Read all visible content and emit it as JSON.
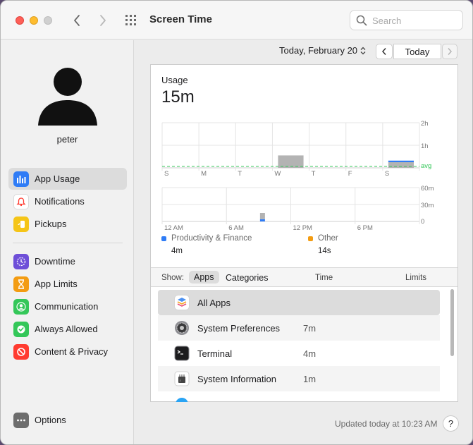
{
  "window": {
    "title": "Screen Time"
  },
  "search": {
    "placeholder": "Search"
  },
  "user": {
    "name": "peter"
  },
  "sidebar": {
    "group1": [
      {
        "label": "App Usage",
        "icon": "bar-chart-icon",
        "color": "#2f7cf6",
        "selected": true
      },
      {
        "label": "Notifications",
        "icon": "bell-icon",
        "color": "#ffffff",
        "selected": false
      },
      {
        "label": "Pickups",
        "icon": "pickup-phone-icon",
        "color": "#f5c518",
        "selected": false
      }
    ],
    "group2": [
      {
        "label": "Downtime",
        "icon": "downtime-icon",
        "color": "#6e4fd8"
      },
      {
        "label": "App Limits",
        "icon": "hourglass-icon",
        "color": "#f39c12"
      },
      {
        "label": "Communication",
        "icon": "person-icon",
        "color": "#34c759"
      },
      {
        "label": "Always Allowed",
        "icon": "checkmark-icon",
        "color": "#34c759"
      },
      {
        "label": "Content & Privacy",
        "icon": "prohibited-icon",
        "color": "#ff3b30"
      }
    ],
    "options": {
      "label": "Options",
      "icon": "ellipsis-icon",
      "color": "#6d6d6d"
    }
  },
  "date_nav": {
    "date": "Today, February 20",
    "today_label": "Today"
  },
  "usage": {
    "label": "Usage",
    "value": "15m"
  },
  "chart_data": [
    {
      "type": "bar",
      "categories": [
        "S",
        "M",
        "T",
        "W",
        "T",
        "F",
        "S"
      ],
      "series": [
        {
          "name": "Productivity & Finance",
          "color": "#2f7cf6",
          "values": [
            0,
            0,
            0,
            0,
            0,
            0,
            0.07
          ]
        },
        {
          "name": "Other",
          "color": "#b3b3b3",
          "values": [
            0,
            0,
            0,
            0.55,
            0,
            0,
            0.25
          ]
        }
      ],
      "y_ticks": [
        "2h",
        "1h",
        "avg"
      ],
      "avg": 0.0
    },
    {
      "type": "bar",
      "x_labels": [
        "12 AM",
        "6 AM",
        "12 PM",
        "6 PM"
      ],
      "y_ticks": [
        "60m",
        "30m",
        "0"
      ],
      "hour": 9,
      "series": [
        {
          "name": "Productivity & Finance",
          "color": "#2f7cf6",
          "minutes": 4
        },
        {
          "name": "Other",
          "color": "#b3b3b3",
          "minutes": 11
        }
      ]
    }
  ],
  "legend": [
    {
      "label": "Productivity & Finance",
      "value": "4m",
      "color": "#2f7cf6"
    },
    {
      "label": "Other",
      "value": "14s",
      "color": "#f39c12"
    }
  ],
  "table": {
    "show_label": "Show:",
    "tab_apps": "Apps",
    "tab_categories": "Categories",
    "col_time": "Time",
    "col_limits": "Limits",
    "rows": [
      {
        "name": "All Apps",
        "time": "",
        "icon": "stack-icon"
      },
      {
        "name": "System Preferences",
        "time": "7m",
        "icon": "gear-icon"
      },
      {
        "name": "Terminal",
        "time": "4m",
        "icon": "terminal-icon"
      },
      {
        "name": "System Information",
        "time": "1m",
        "icon": "chip-icon"
      }
    ]
  },
  "footer": {
    "updated": "Updated today at 10:23 AM",
    "help": "?"
  }
}
